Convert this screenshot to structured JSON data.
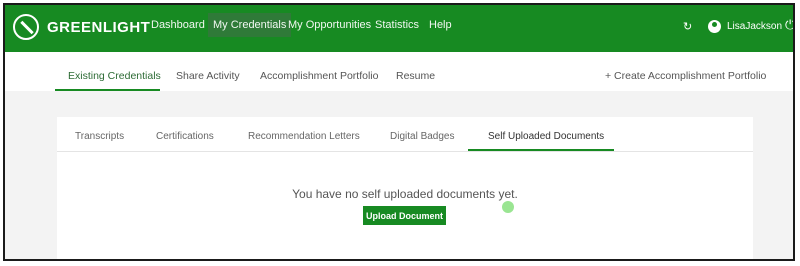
{
  "brand": {
    "name": "GREENLIGHT"
  },
  "nav": {
    "items": [
      {
        "label": "Dashboard"
      },
      {
        "label": "My Credentials"
      },
      {
        "label": "My Opportunities"
      },
      {
        "label": "Statistics"
      },
      {
        "label": "Help"
      }
    ],
    "active_index": 1,
    "user": {
      "name": "LisaJackson"
    }
  },
  "subnav": {
    "items": [
      {
        "label": "Existing Credentials"
      },
      {
        "label": "Share Activity"
      },
      {
        "label": "Accomplishment Portfolio"
      },
      {
        "label": "Resume"
      }
    ],
    "active_index": 0,
    "create_label": "+ Create Accomplishment Portfolio"
  },
  "tabs": {
    "items": [
      {
        "label": "Transcripts"
      },
      {
        "label": "Certifications"
      },
      {
        "label": "Recommendation Letters"
      },
      {
        "label": "Digital Badges"
      },
      {
        "label": "Self Uploaded Documents"
      }
    ],
    "active_index": 4
  },
  "content": {
    "empty_message": "You have no self uploaded documents yet.",
    "upload_button_label": "Upload Document"
  },
  "colors": {
    "brand_green": "#178a22",
    "active_nav_bg": "#2f7a38"
  },
  "icons": {
    "logo": "greenlight-logo-icon",
    "refresh": "refresh-icon",
    "user": "user-icon",
    "power": "power-icon"
  }
}
